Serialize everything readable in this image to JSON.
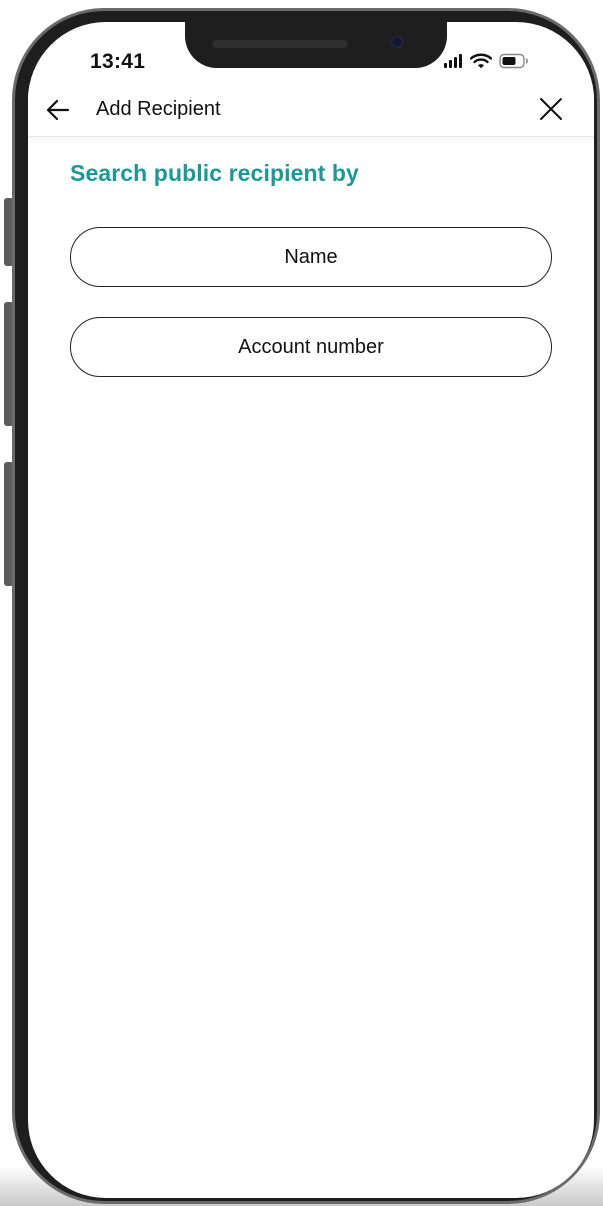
{
  "status_bar": {
    "time": "13:41",
    "signal_icon": "signal-bars-icon",
    "wifi_icon": "wifi-icon",
    "battery_icon": "battery-icon"
  },
  "header": {
    "title": "Add Recipient",
    "back_icon": "arrow-left-icon",
    "close_icon": "close-icon"
  },
  "main": {
    "section_title": "Search public recipient by",
    "options": [
      {
        "label": "Name"
      },
      {
        "label": "Account number"
      }
    ]
  },
  "colors": {
    "accent": "#1a9a96",
    "text": "#111111",
    "frame": "#1e1e1e"
  }
}
